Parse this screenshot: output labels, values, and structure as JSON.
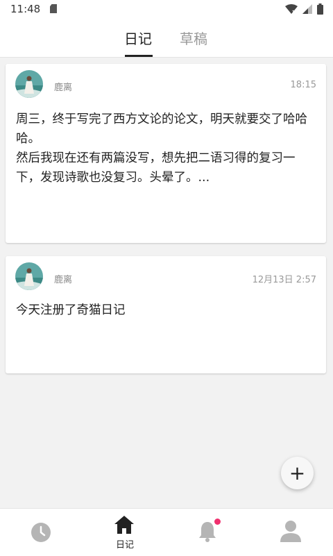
{
  "status_bar": {
    "time": "11:48",
    "icons": [
      "sd-card-icon",
      "wifi-icon",
      "signal-icon",
      "battery-icon"
    ]
  },
  "header": {
    "tabs": [
      {
        "label": "日记",
        "active": true
      },
      {
        "label": "草稿",
        "active": false
      }
    ]
  },
  "entries": [
    {
      "author": "鹿离",
      "time": "18:15",
      "content": "周三，终于写完了西方文论的论文，明天就要交了哈哈哈。\n然后我现在还有两篇没写，想先把二语习得的复习一下，发现诗歌也没复习。头晕了。..."
    },
    {
      "author": "鹿离",
      "time": "12月13日 2:57",
      "content": "今天注册了奇猫日记"
    }
  ],
  "fab": {
    "label": "+"
  },
  "bottom_nav": {
    "items": [
      {
        "icon": "clock-icon",
        "label": ""
      },
      {
        "icon": "home-icon",
        "label": "日记",
        "active": true
      },
      {
        "icon": "bell-icon",
        "label": "",
        "badge": true
      },
      {
        "icon": "person-icon",
        "label": ""
      }
    ]
  },
  "colors": {
    "accent_badge": "#f0306e",
    "background": "#f2f2f2",
    "icon_gray": "#b5b5b5"
  }
}
